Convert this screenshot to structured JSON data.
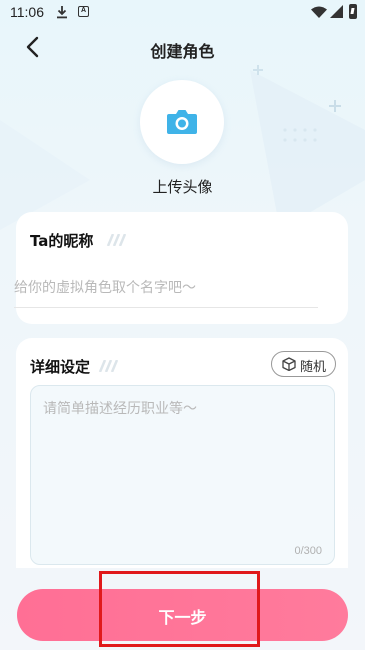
{
  "status_bar": {
    "time": "11:06",
    "icons": [
      "download-icon",
      "a-icon",
      "wifi-icon",
      "signal-icon",
      "battery-icon"
    ],
    "a_glyph": "A"
  },
  "header": {
    "title": "创建角色",
    "back_icon": "chevron-left-icon"
  },
  "avatar": {
    "icon": "camera-icon",
    "label": "上传头像",
    "icon_color": "#3fb3e8"
  },
  "nickname": {
    "title": "Ta的昵称",
    "value": "",
    "placeholder": "给你的虚拟角色取个名字吧～"
  },
  "detail": {
    "title": "详细设定",
    "random_label": "随机",
    "random_icon": "dice-icon",
    "value": "",
    "placeholder": "请简单描述经历职业等～",
    "char_count": "0/300"
  },
  "footer": {
    "next_label": "下一步",
    "button_color": "#ff7096",
    "highlight_color": "#e0191b"
  }
}
